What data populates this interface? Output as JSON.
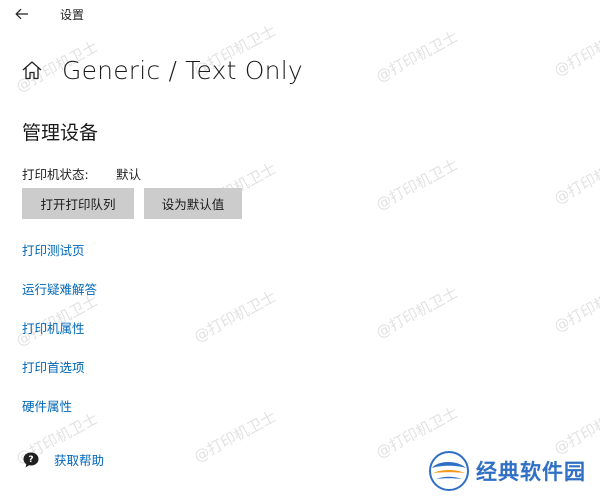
{
  "titlebar": {
    "back_icon": "arrow-left-icon",
    "title": "设置"
  },
  "header": {
    "home_icon": "home-icon",
    "title": "Generic / Text Only"
  },
  "manage": {
    "section_title": "管理设备",
    "status_label": "打印机状态:",
    "status_value": "默认",
    "open_queue_label": "打开打印队列",
    "set_default_label": "设为默认值"
  },
  "links": [
    "打印测试页",
    "运行疑难解答",
    "打印机属性",
    "打印首选项",
    "硬件属性"
  ],
  "help": {
    "icon": "help-chat-icon",
    "label": "获取帮助"
  },
  "watermark": {
    "text": "@打印机卫士"
  },
  "logo": {
    "text": "经典软件园",
    "icon": "site-logo-icon"
  },
  "colors": {
    "link": "#0067b8",
    "button_bg": "#cccccc",
    "logo": "#2f6fc4"
  }
}
